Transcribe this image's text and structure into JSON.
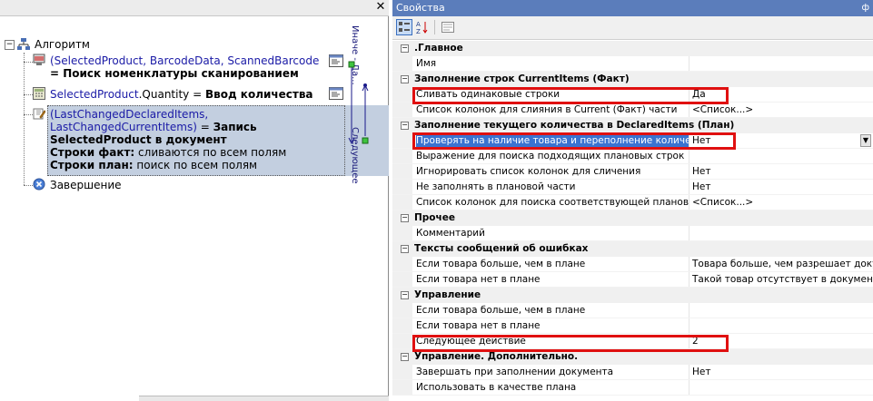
{
  "left_panel": {
    "close_glyph": "✕",
    "root": {
      "label": "Алгоритм"
    },
    "nodes": [
      {
        "line1": "(SelectedProduct, BarcodeData, ScannedBarcode",
        "line2": "= Поиск номенклатуры сканированием"
      },
      {
        "blue": "SelectedProduct",
        "rest": ".Quantity = ",
        "bold": "Ввод количества"
      },
      {
        "line1": "(LastChangedDeclaredItems,",
        "line2_blue": "LastChangedCurrentItems)",
        "line2_rest": " = ",
        "line2_bold": "Запись",
        "line3_bold": "SelectedProduct в документ",
        "line4_bold": "Строки факт:",
        "line4_rest": " сливаются по всем полям",
        "line5_bold": "Строки план:",
        "line5_rest": " поиск по всем полям"
      },
      {
        "label": "Завершение"
      }
    ],
    "vertical_labels": [
      "Иначе - Да...",
      "Следующее"
    ]
  },
  "properties_panel": {
    "title": "Свойства",
    "pin_glyph": "ф",
    "rows": [
      {
        "type": "cat",
        "name": ".Главное"
      },
      {
        "type": "prop",
        "name": "Имя",
        "value": ""
      },
      {
        "type": "cat",
        "name": "Заполнение строк CurrentItems (Факт)"
      },
      {
        "type": "prop",
        "name": "Сливать одинаковые строки",
        "value": "Да"
      },
      {
        "type": "prop",
        "name": "Список колонок для слияния в Current (Факт) части",
        "value": "<Список...>"
      },
      {
        "type": "cat",
        "name": "Заполнение текущего количества в DeclaredItems (План)"
      },
      {
        "type": "prop",
        "name": "Проверять на наличие товара и переполнение количества",
        "value": "Нет",
        "selected": true
      },
      {
        "type": "prop",
        "name": "Выражение для поиска подходящих плановых строк",
        "value": ""
      },
      {
        "type": "prop",
        "name": "Игнорировать список колонок для сличения",
        "value": "Нет"
      },
      {
        "type": "prop",
        "name": "Не заполнять в плановой части",
        "value": "Нет"
      },
      {
        "type": "prop",
        "name": "Список колонок для поиска соответствующей плановой строки",
        "value": "<Список...>"
      },
      {
        "type": "cat",
        "name": "Прочее"
      },
      {
        "type": "prop",
        "name": "Комментарий",
        "value": ""
      },
      {
        "type": "cat",
        "name": "Тексты сообщений об ошибках"
      },
      {
        "type": "prop",
        "name": "Если товара больше, чем в плане",
        "value": "Товара больше, чем разрешает докуме"
      },
      {
        "type": "prop",
        "name": "Если товара нет в плане",
        "value": "Такой товар отсутствует в документе"
      },
      {
        "type": "cat",
        "name": "Управление"
      },
      {
        "type": "prop",
        "name": "Если товара больше, чем в плане",
        "value": ""
      },
      {
        "type": "prop",
        "name": "Если товара нет в плане",
        "value": ""
      },
      {
        "type": "prop",
        "name": "Следующее действие",
        "value": "2"
      },
      {
        "type": "cat",
        "name": "Управление. Дополнительно."
      },
      {
        "type": "prop",
        "name": "Завершать при заполнении документа",
        "value": "Нет"
      },
      {
        "type": "prop",
        "name": "Использовать в качестве плана",
        "value": ""
      }
    ],
    "colors": {
      "title_bg": "#5b7dbb",
      "selection": "#3a73d1",
      "highlight_box": "#e01010"
    }
  }
}
